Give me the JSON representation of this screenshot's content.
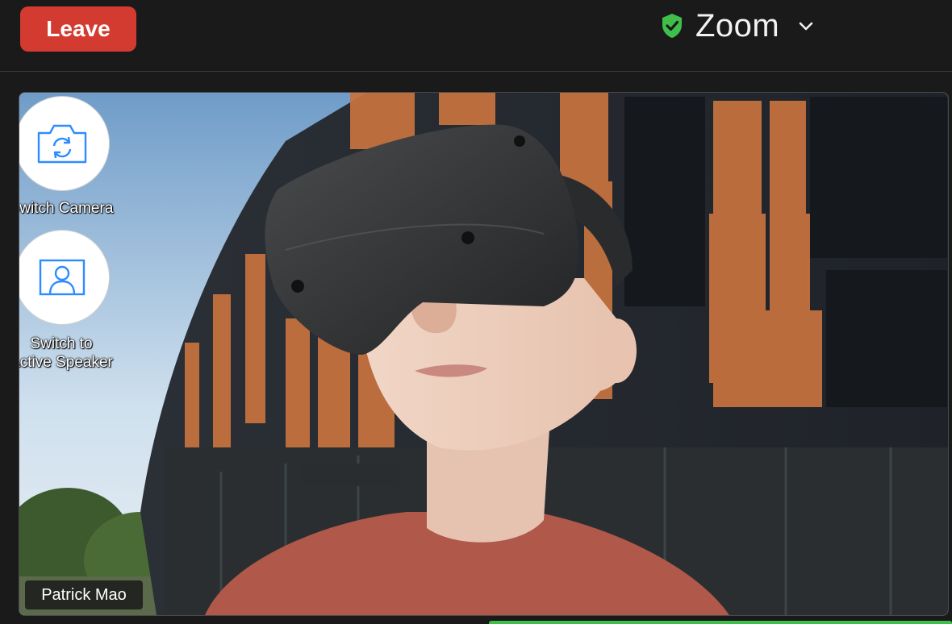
{
  "header": {
    "leave_label": "Leave",
    "app_title": "Zoom",
    "leave_color": "#d43b30",
    "shield_color": "#3fbf4a"
  },
  "video": {
    "participant_name": "Patrick Mao"
  },
  "controls": {
    "switch_camera_label": "Switch Camera",
    "switch_speaker_label_line1": "Switch to",
    "switch_speaker_label_line2": "Active Speaker"
  },
  "icons": {
    "camera": "camera-switch-icon",
    "speaker": "active-speaker-icon",
    "shield": "shield-check-icon",
    "chevron": "chevron-down-icon"
  }
}
